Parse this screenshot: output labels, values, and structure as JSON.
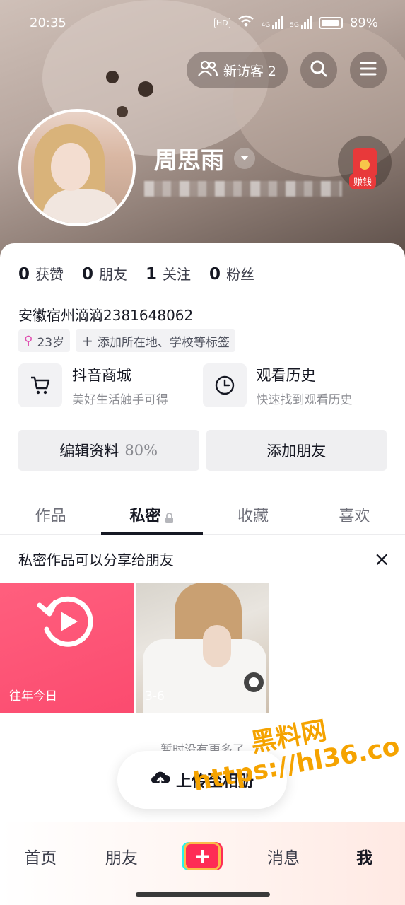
{
  "status_bar": {
    "time": "20:35",
    "network_labels": [
      "HD",
      "4G",
      "5G"
    ],
    "battery_percent": "89%"
  },
  "header": {
    "visitor_label": "新访客 2",
    "search_icon": "search-icon",
    "menu_icon": "menu-icon",
    "profile_name": "周思雨",
    "earn_label": "赚钱"
  },
  "stats": [
    {
      "num": "0",
      "label": "获赞"
    },
    {
      "num": "0",
      "label": "朋友"
    },
    {
      "num": "1",
      "label": "关注"
    },
    {
      "num": "0",
      "label": "粉丝"
    }
  ],
  "bio": "安徽宿州滴滴2381648062",
  "tags": {
    "age": "23岁",
    "add_tag": "添加所在地、学校等标签"
  },
  "shortcuts": [
    {
      "title": "抖音商城",
      "subtitle": "美好生活触手可得",
      "icon": "cart-icon"
    },
    {
      "title": "观看历史",
      "subtitle": "快速找到观看历史",
      "icon": "clock-icon"
    }
  ],
  "actions": {
    "edit_label": "编辑资料",
    "edit_percent": "80%",
    "add_friend_label": "添加朋友"
  },
  "tabs": [
    {
      "label": "作品",
      "active": false
    },
    {
      "label": "私密",
      "active": true
    },
    {
      "label": "收藏",
      "active": false
    },
    {
      "label": "喜欢",
      "active": false
    }
  ],
  "notice": {
    "text": "私密作品可以分享给朋友",
    "close": "×"
  },
  "grid": [
    {
      "label": "往年今日"
    },
    {
      "label": "3-6"
    }
  ],
  "no_more_text": "暂时没有更多了",
  "upload_label": "上传至相册",
  "watermark": {
    "line1": "黑料网",
    "line2": "https://hl36.co"
  },
  "bottom_nav": {
    "home": "首页",
    "friends": "朋友",
    "plus": "+",
    "messages": "消息",
    "me": "我"
  },
  "colors": {
    "accent": "#fe2c55",
    "memory_tile": "#fb4b6f",
    "watermark": "#f5a300"
  }
}
